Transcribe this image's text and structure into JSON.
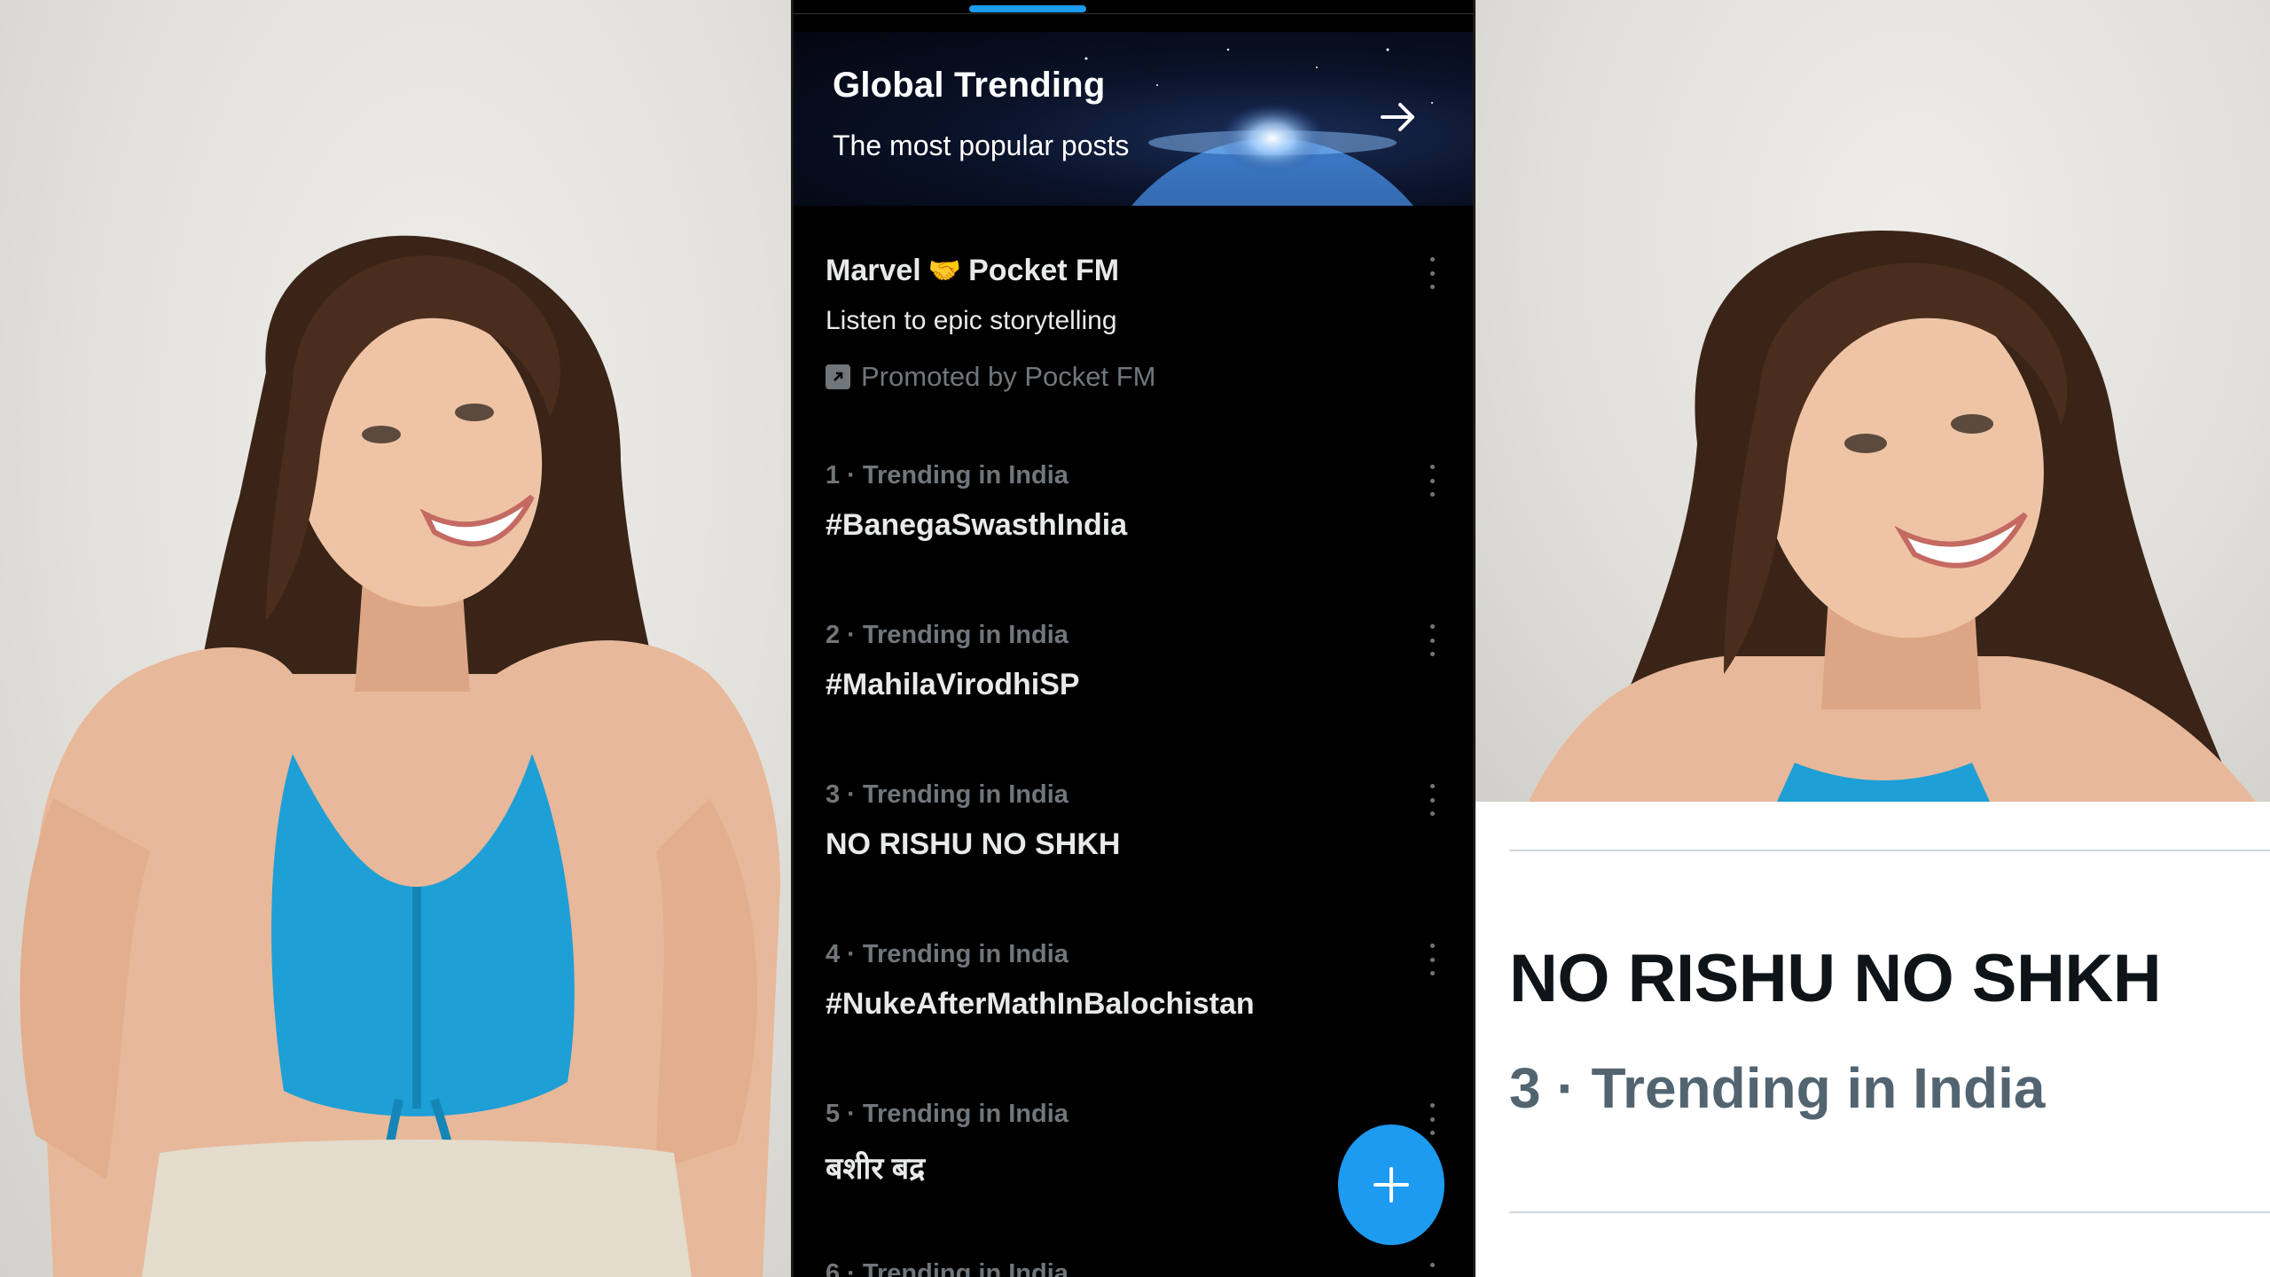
{
  "banner": {
    "title": "Global Trending",
    "subtitle": "The most popular posts"
  },
  "promoted": {
    "title_left": "Marvel",
    "title_emoji": "🤝",
    "title_right": "Pocket FM",
    "description": "Listen to epic storytelling",
    "promoted_by": "Promoted by Pocket FM"
  },
  "trends": [
    {
      "meta": "1 · Trending in India",
      "topic": "#BanegaSwasthIndia"
    },
    {
      "meta": "2 · Trending in India",
      "topic": "#MahilaVirodhiSP"
    },
    {
      "meta": "3 · Trending in India",
      "topic": "NO RISHU NO SHKH"
    },
    {
      "meta": "4 · Trending in India",
      "topic": "#NukeAfterMathInBalochistan"
    },
    {
      "meta": "5 · Trending in India",
      "topic": "बशीर बद्र"
    },
    {
      "meta": "6 · Trending in India",
      "topic": ""
    }
  ],
  "zoom": {
    "topic": "NO RISHU NO SHKH",
    "meta": "3 · Trending in India"
  },
  "colors": {
    "accent": "#1d9bf0",
    "background": "#000000",
    "muted_text": "#71767b",
    "primary_text": "#e7e9ea"
  },
  "icons": {
    "banner_arrow": "arrow-right-icon",
    "more": "more-vertical-icon",
    "promoted": "promoted-icon",
    "compose": "plus-icon"
  }
}
